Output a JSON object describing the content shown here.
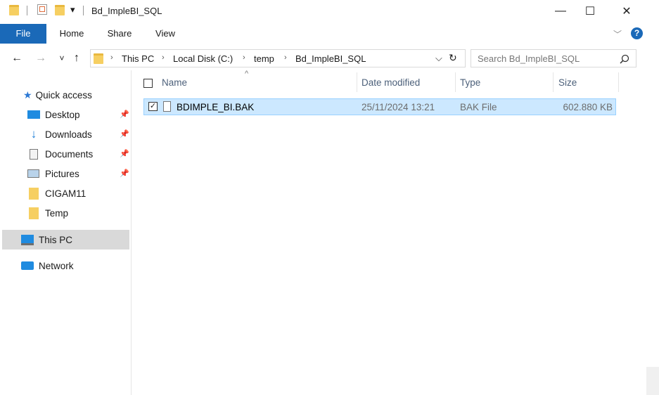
{
  "window": {
    "title": "Bd_ImpleBI_SQL",
    "minimize": "—",
    "maximize": "☐",
    "close": "✕",
    "qa_dropdown": "▾"
  },
  "ribbon": {
    "tabs": [
      "File",
      "Home",
      "Share",
      "View"
    ],
    "expand": "﹀",
    "help": "?"
  },
  "address": {
    "back": "←",
    "forward": "→",
    "recent": "˅",
    "up": "↑",
    "crumbs": [
      "This PC",
      "Local Disk (C:)",
      "temp",
      "Bd_ImpleBI_SQL"
    ],
    "separator": "›",
    "dropdown": "⌵",
    "refresh": "↻"
  },
  "search": {
    "placeholder": "Search Bd_ImpleBI_SQL",
    "icon": "search-icon"
  },
  "navpane": {
    "quick_access": "Quick access",
    "pinned": [
      "Desktop",
      "Downloads",
      "Documents",
      "Pictures"
    ],
    "folders": [
      "CIGAM11",
      "Temp"
    ],
    "this_pc": "This PC",
    "network": "Network",
    "pin_glyph": "📌"
  },
  "columns": {
    "name": "Name",
    "date": "Date modified",
    "type": "Type",
    "size": "Size",
    "sort_glyph": "^"
  },
  "files": [
    {
      "name": "BDIMPLE_BI.BAK",
      "date": "25/11/2024 13:21",
      "type": "BAK File",
      "size": "602.880 KB",
      "checked": "✓"
    }
  ],
  "colors": {
    "accent": "#1a69b8",
    "selection": "#cce8ff",
    "selection_border": "#99d1ff",
    "folder": "#f6cf62"
  }
}
